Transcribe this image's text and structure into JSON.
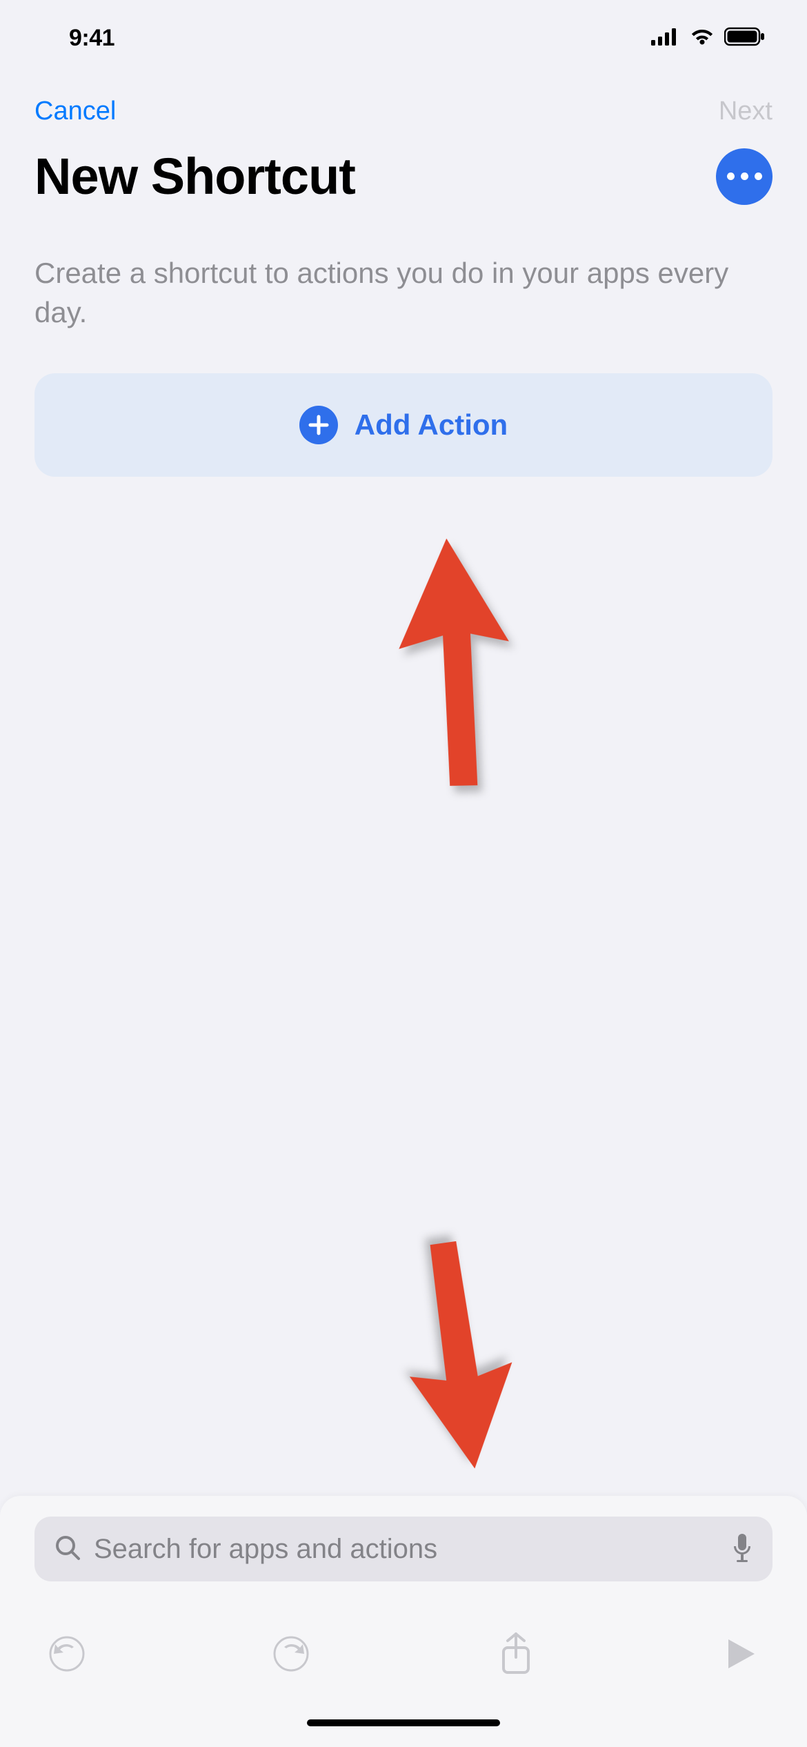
{
  "status": {
    "time": "9:41"
  },
  "nav": {
    "cancel_label": "Cancel",
    "next_label": "Next"
  },
  "header": {
    "title": "New Shortcut",
    "subtitle": "Create a shortcut to actions you do in your apps every day."
  },
  "main": {
    "add_action_label": "Add Action"
  },
  "search": {
    "placeholder": "Search for apps and actions"
  },
  "colors": {
    "accent_blue": "#007aff",
    "brand_blue": "#2f6feb",
    "disabled_gray": "#c7c7cc",
    "subtitle_gray": "#8e8e93",
    "card_bg": "#e2eaf7",
    "search_bg": "#e4e3e9",
    "annotation_red": "#e2432a"
  }
}
